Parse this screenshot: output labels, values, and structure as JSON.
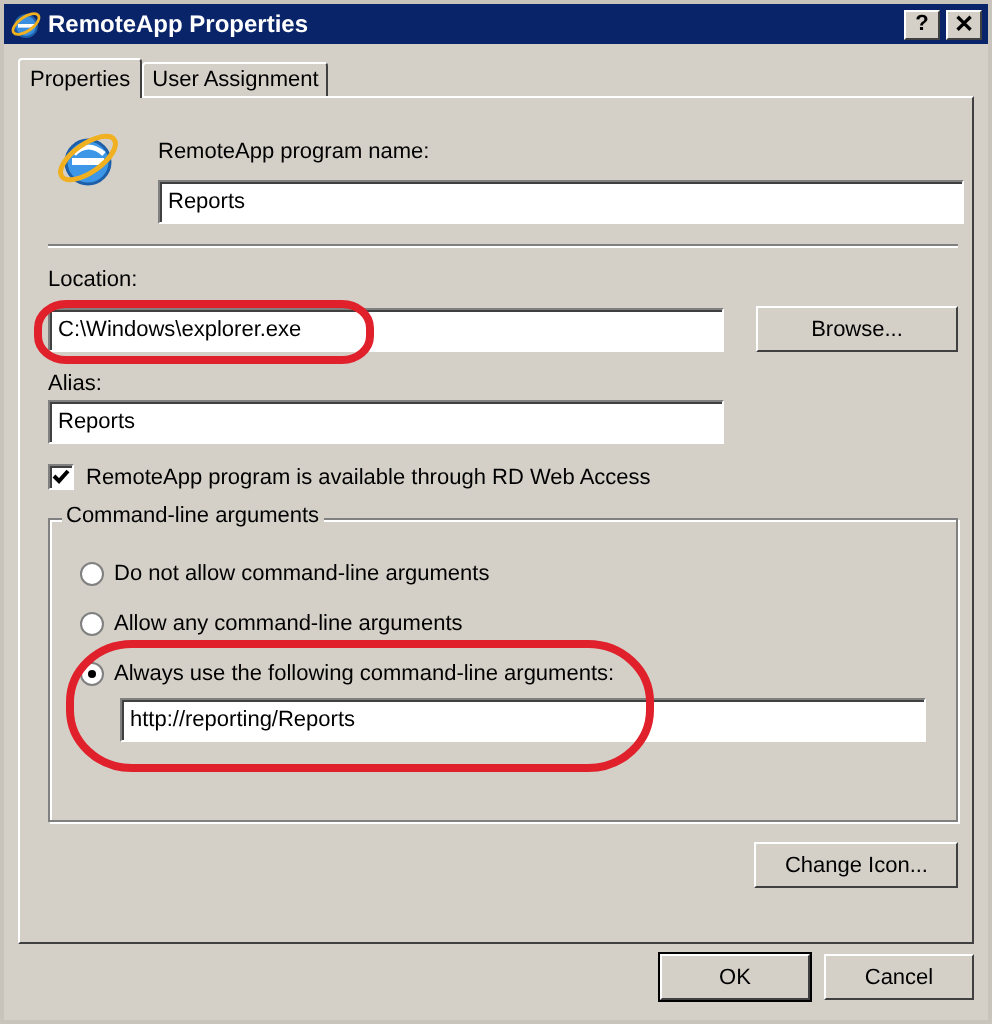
{
  "window": {
    "title": "RemoteApp Properties",
    "controls": [
      {
        "kind": "help",
        "label": "?"
      },
      {
        "kind": "close",
        "label": "✕"
      }
    ]
  },
  "tabs": [
    {
      "label": "Properties",
      "selected": true
    },
    {
      "label": "User Assignment",
      "selected": false
    }
  ],
  "program_name": {
    "label": "RemoteApp program name:",
    "value": "Reports"
  },
  "location": {
    "label": "Location:",
    "value": "C:\\Windows\\explorer.exe",
    "circled": true,
    "button": "Browse..."
  },
  "alias": {
    "label": "Alias:",
    "value": "Reports"
  },
  "web_access": {
    "label": "RemoteApp program is available through RD Web Access",
    "checked": true
  },
  "command_line": {
    "title": "Command-line arguments",
    "options": [
      {
        "label": "Do not allow command-line arguments",
        "selected": false,
        "circled": false
      },
      {
        "label": "Allow any command-line arguments",
        "selected": false,
        "circled": false
      },
      {
        "label": "Always use the following command-line arguments:",
        "selected": true,
        "circled": true
      }
    ],
    "arguments": "http://reporting/Reports"
  },
  "change_icon_button": "Change Icon...",
  "buttons": [
    {
      "label": "OK",
      "default": true
    },
    {
      "label": "Cancel",
      "default": false
    }
  ]
}
